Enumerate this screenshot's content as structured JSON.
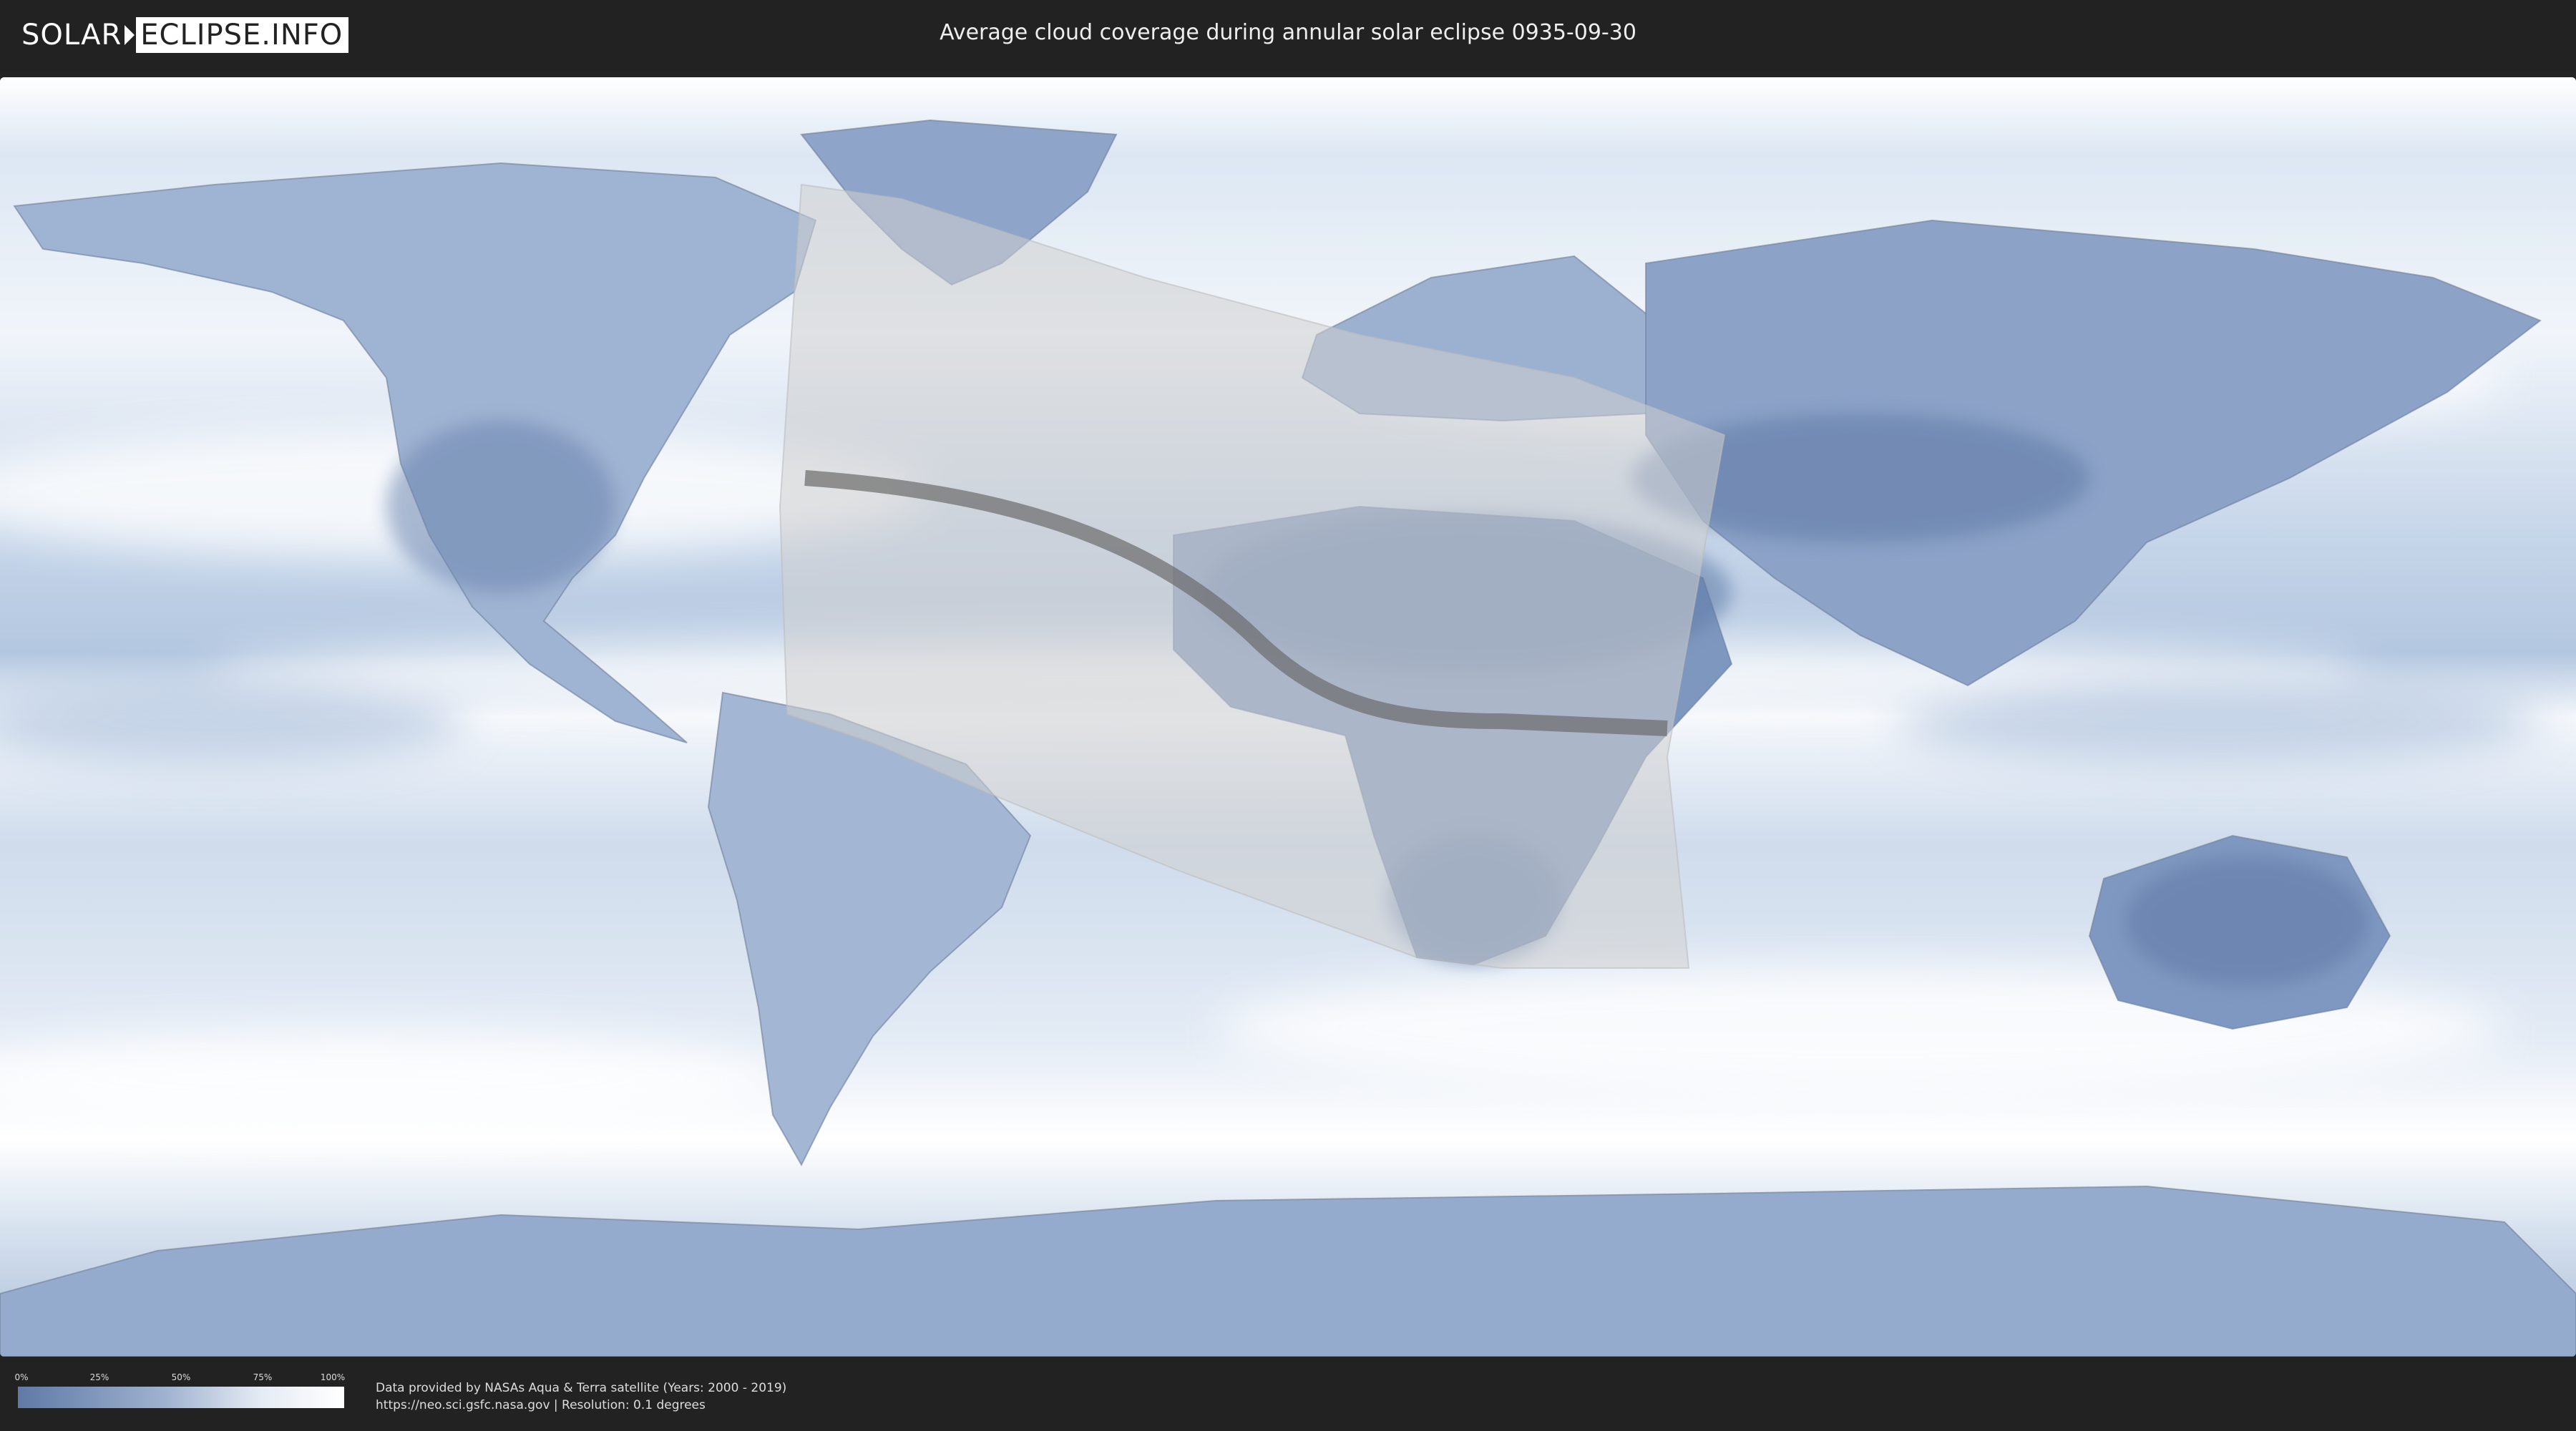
{
  "header": {
    "logo_left": "SOLAR",
    "logo_right": "ECLIPSE.INFO",
    "title": "Average cloud coverage during annular solar eclipse 0935-09-30"
  },
  "map": {
    "ocean_color": "#e9f0f8",
    "land_cloudy_color": "#7e97bf",
    "clear_band_color": "#ffffff",
    "eclipse_region_color": "#d0d0d0",
    "central_path_color": "#6b6b6b"
  },
  "legend": {
    "ticks": [
      "0%",
      "25%",
      "50%",
      "75%",
      "100%"
    ],
    "colors": [
      "#5f7aa6",
      "#ffffff"
    ]
  },
  "footer": {
    "credit_line1": "Data provided by NASAs Aqua & Terra satellite (Years: 2000 - 2019)",
    "credit_line2": "https://neo.sci.gsfc.nasa.gov | Resolution: 0.1 degrees"
  }
}
